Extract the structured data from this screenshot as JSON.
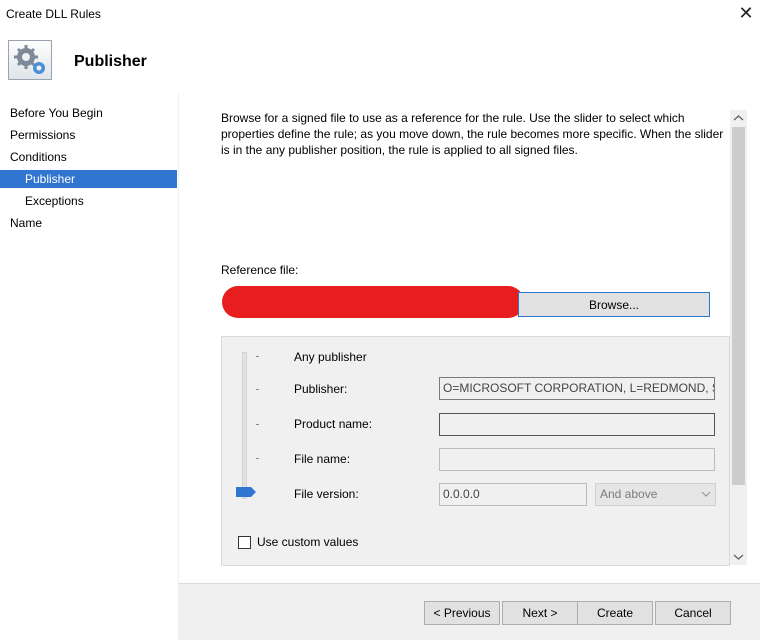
{
  "window": {
    "title": "Create DLL Rules",
    "close_glyph": "✕"
  },
  "header": {
    "title": "Publisher",
    "icon": "gears-icon"
  },
  "nav": {
    "items": [
      {
        "label": "Before You Begin"
      },
      {
        "label": "Permissions"
      },
      {
        "label": "Conditions"
      },
      {
        "label": "Publisher",
        "selected": true
      },
      {
        "label": "Exceptions"
      },
      {
        "label": "Name"
      }
    ]
  },
  "content": {
    "description": "Browse for a signed file to use as a reference for the rule. Use the slider to select which properties define the rule; as you move down, the rule becomes more specific. When the slider is in the any publisher position, the rule is applied to all signed files.",
    "reference_label": "Reference file:",
    "browse_label": "Browse...",
    "rows": {
      "any_publisher": "Any publisher",
      "publisher": "Publisher:",
      "product_name": "Product name:",
      "file_name": "File name:",
      "file_version": "File version:"
    },
    "values": {
      "publisher": "O=MICROSOFT CORPORATION, L=REDMOND, S=W",
      "product_name": "",
      "file_name": "",
      "file_version": "0.0.0.0",
      "version_qualifier": "And above"
    },
    "slider_level": "File version",
    "custom_values_label": "Use custom values",
    "custom_values_checked": false
  },
  "footer": {
    "previous": "< Previous",
    "next": "Next >",
    "create": "Create",
    "cancel": "Cancel"
  },
  "colors": {
    "accent": "#3076d1",
    "redaction": "#e81e1e"
  }
}
